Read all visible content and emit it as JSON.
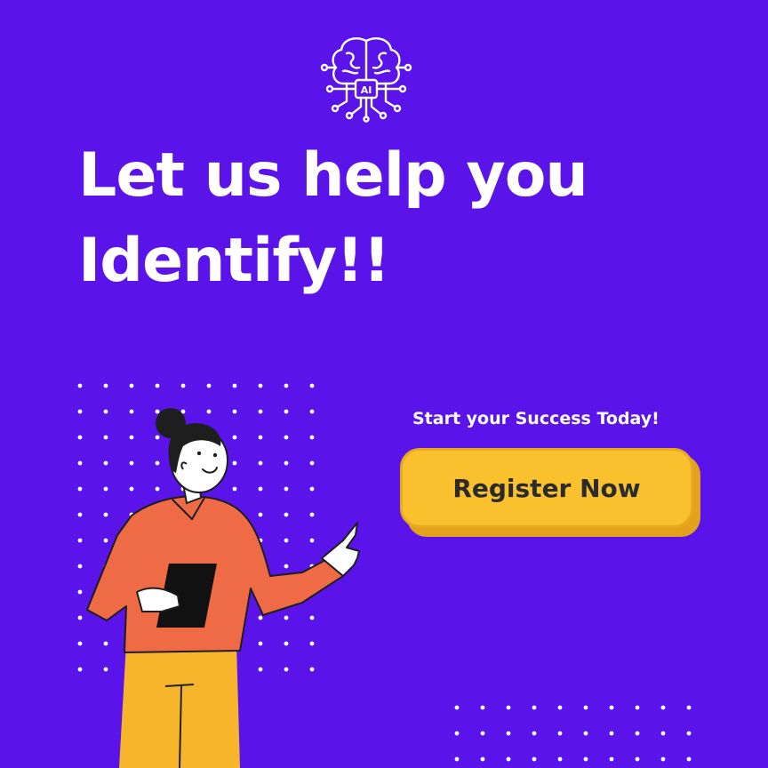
{
  "logo": {
    "icon": "ai-brain-circuit-icon",
    "text": "AI"
  },
  "headline": {
    "line1": "Let us help you",
    "line2": "Identify!!"
  },
  "tagline": "Start your Success Today!",
  "cta": {
    "label": "Register Now"
  },
  "colors": {
    "background": "#5a14ea",
    "button": "#fac12f",
    "button_shadow": "#e3a21c",
    "text_light": "#ffffff",
    "text_dark": "#2b2b2b",
    "shirt": "#ef6b45",
    "pants": "#f6b52b"
  }
}
